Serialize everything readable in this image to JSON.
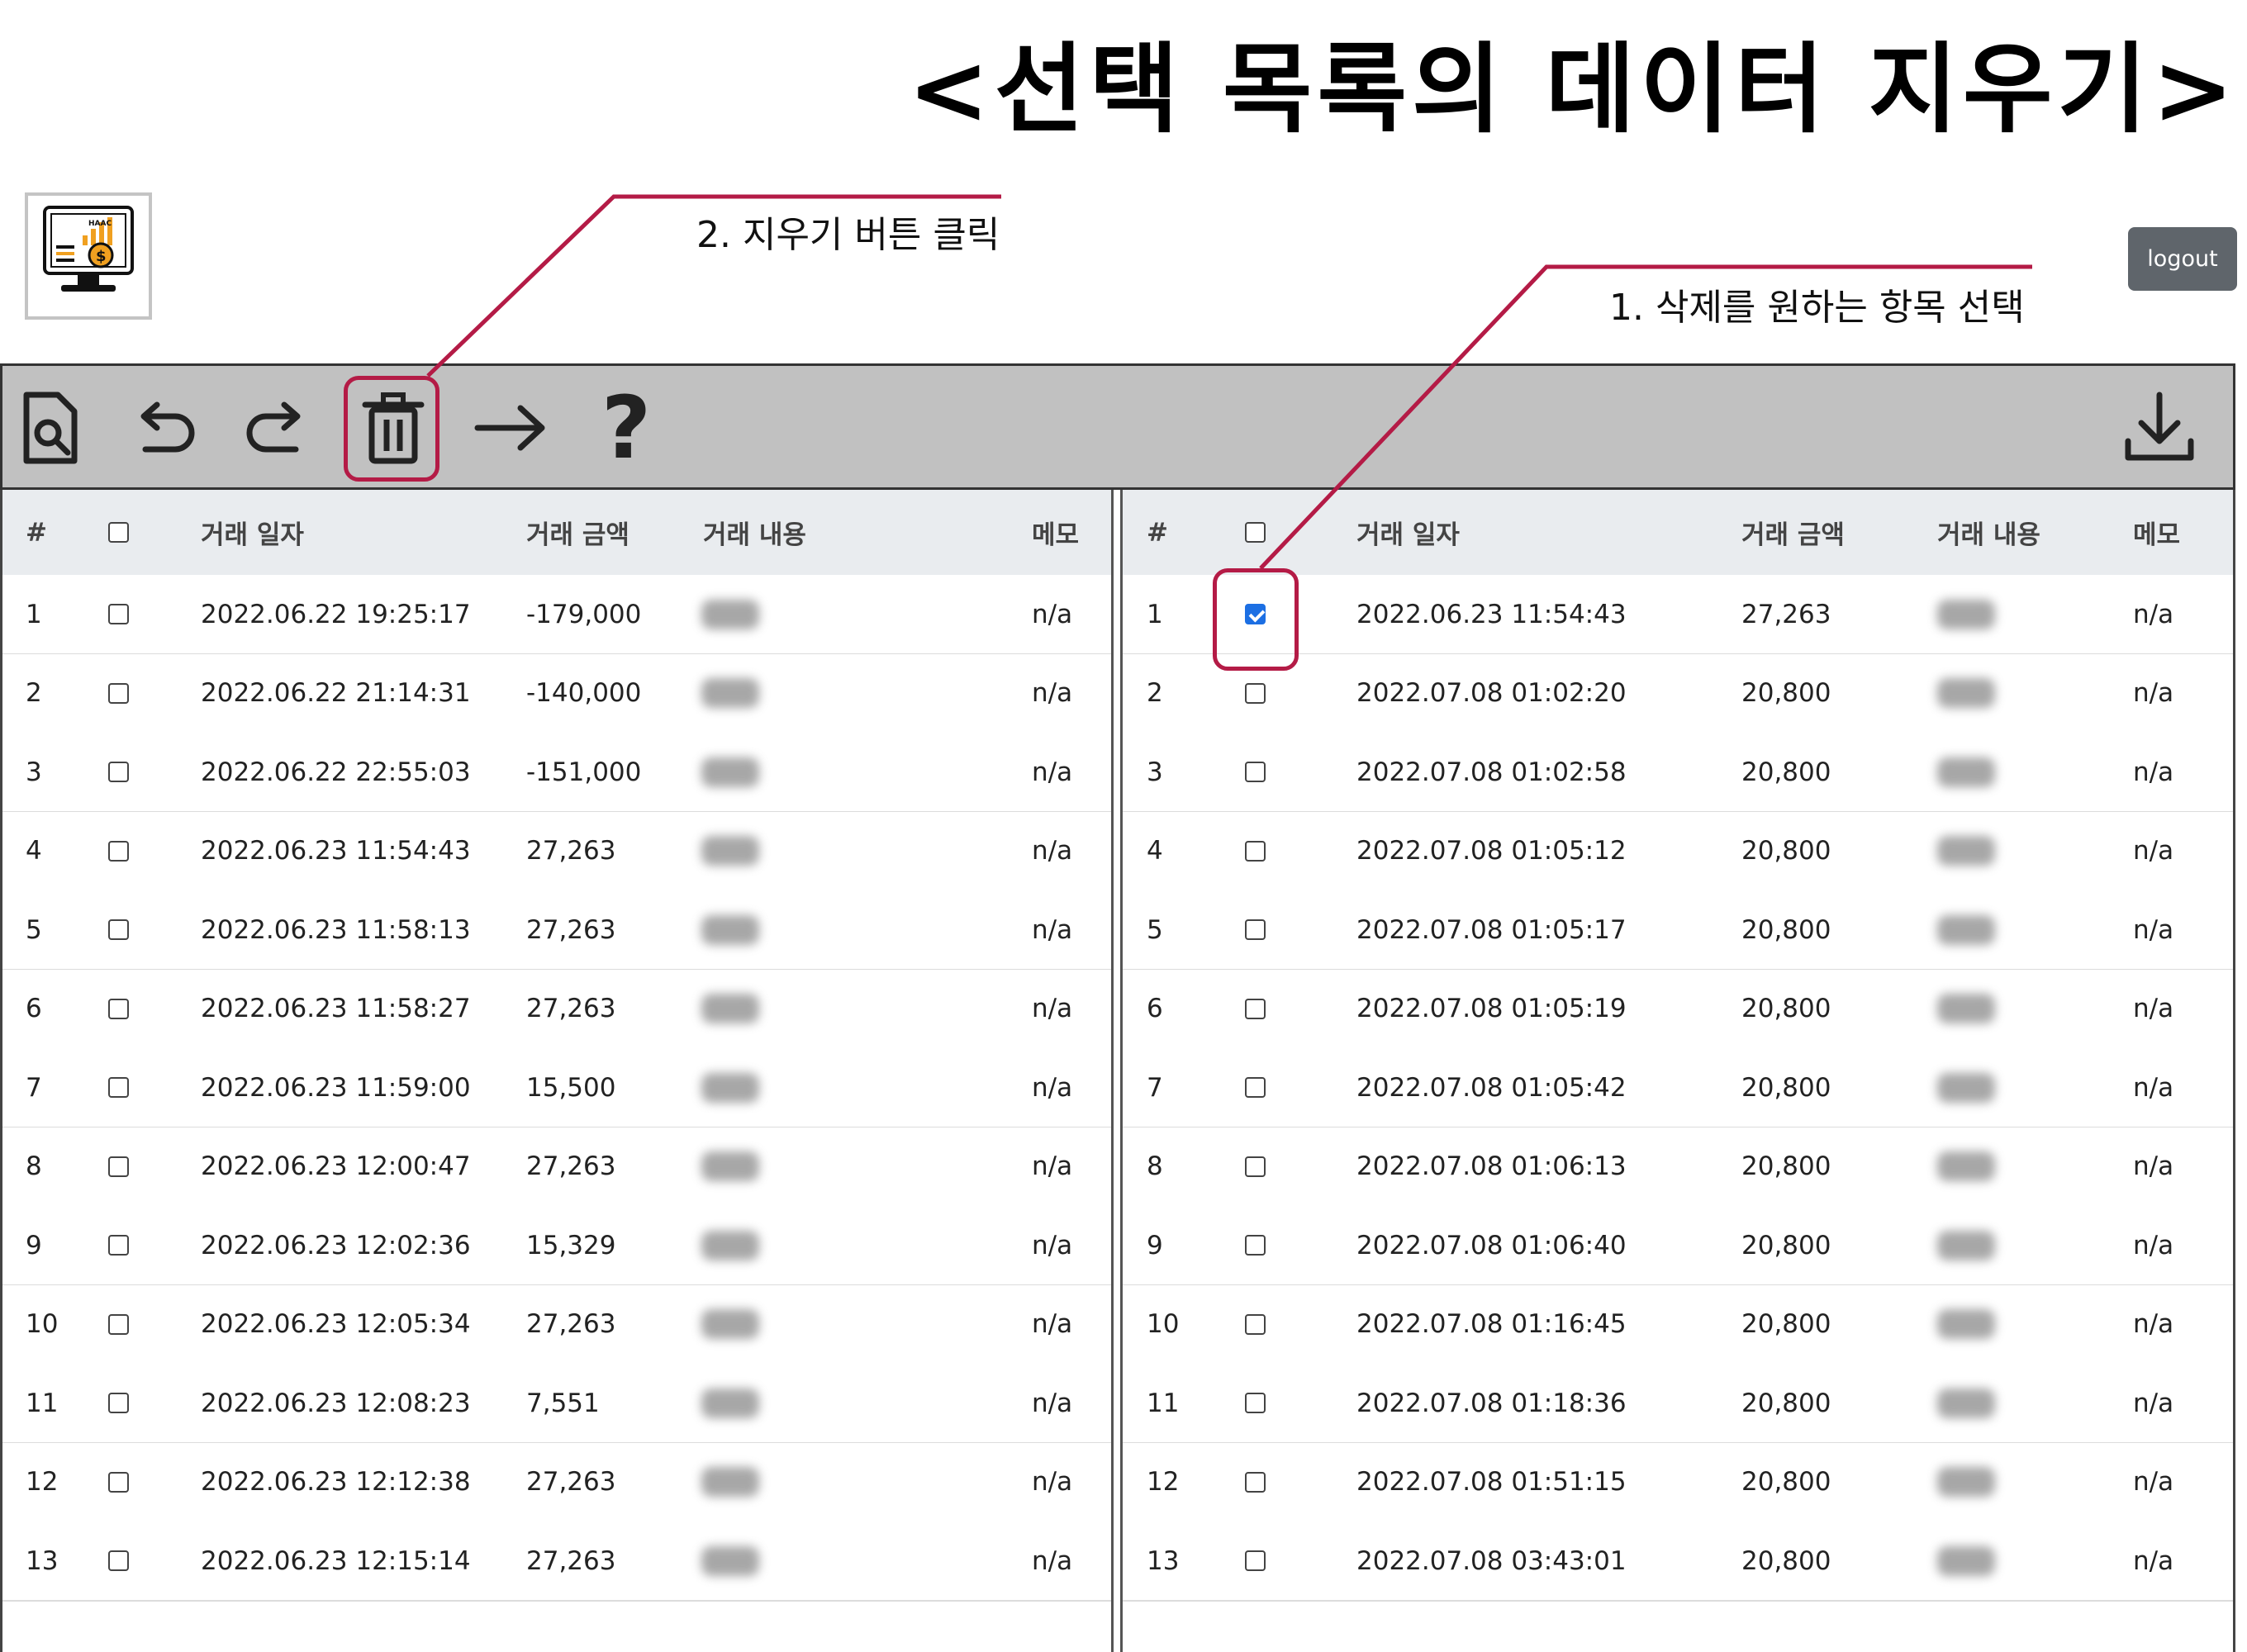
{
  "title": "<선택 목록의 데이터 지우기>",
  "logo": {
    "icon": "finance-monitor-logo-icon",
    "text": "HAAC"
  },
  "header": {
    "logout_label": "logout"
  },
  "toolbar": {
    "buttons": [
      {
        "icon": "file-search-icon"
      },
      {
        "icon": "undo-icon"
      },
      {
        "icon": "redo-icon"
      },
      {
        "icon": "trash-icon"
      },
      {
        "icon": "arrow-right-icon"
      },
      {
        "icon": "help-icon",
        "glyph": "?"
      },
      {
        "icon": "download-icon"
      }
    ]
  },
  "annotations": {
    "step1": "1. 삭제를 원하는 항목 선택",
    "step2": "2. 지우기 버튼 클릭",
    "color": "#b41b46"
  },
  "columns": {
    "num": "#",
    "date": "거래 일자",
    "amount": "거래 금액",
    "content": "거래 내용",
    "memo": "메모"
  },
  "left_table": {
    "rows": [
      {
        "num": "1",
        "date": "2022.06.22 19:25:17",
        "amount": "-179,000",
        "memo": "n/a",
        "checked": false
      },
      {
        "num": "2",
        "date": "2022.06.22 21:14:31",
        "amount": "-140,000",
        "memo": "n/a",
        "checked": false
      },
      {
        "num": "3",
        "date": "2022.06.22 22:55:03",
        "amount": "-151,000",
        "memo": "n/a",
        "checked": false
      },
      {
        "num": "4",
        "date": "2022.06.23 11:54:43",
        "amount": "27,263",
        "memo": "n/a",
        "checked": false
      },
      {
        "num": "5",
        "date": "2022.06.23 11:58:13",
        "amount": "27,263",
        "memo": "n/a",
        "checked": false
      },
      {
        "num": "6",
        "date": "2022.06.23 11:58:27",
        "amount": "27,263",
        "memo": "n/a",
        "checked": false
      },
      {
        "num": "7",
        "date": "2022.06.23 11:59:00",
        "amount": "15,500",
        "memo": "n/a",
        "checked": false
      },
      {
        "num": "8",
        "date": "2022.06.23 12:00:47",
        "amount": "27,263",
        "memo": "n/a",
        "checked": false
      },
      {
        "num": "9",
        "date": "2022.06.23 12:02:36",
        "amount": "15,329",
        "memo": "n/a",
        "checked": false
      },
      {
        "num": "10",
        "date": "2022.06.23 12:05:34",
        "amount": "27,263",
        "memo": "n/a",
        "checked": false
      },
      {
        "num": "11",
        "date": "2022.06.23 12:08:23",
        "amount": "7,551",
        "memo": "n/a",
        "checked": false
      },
      {
        "num": "12",
        "date": "2022.06.23 12:12:38",
        "amount": "27,263",
        "memo": "n/a",
        "checked": false
      },
      {
        "num": "13",
        "date": "2022.06.23 12:15:14",
        "amount": "27,263",
        "memo": "n/a",
        "checked": false
      }
    ]
  },
  "right_table": {
    "rows": [
      {
        "num": "1",
        "date": "2022.06.23 11:54:43",
        "amount": "27,263",
        "memo": "n/a",
        "checked": true
      },
      {
        "num": "2",
        "date": "2022.07.08 01:02:20",
        "amount": "20,800",
        "memo": "n/a",
        "checked": false
      },
      {
        "num": "3",
        "date": "2022.07.08 01:02:58",
        "amount": "20,800",
        "memo": "n/a",
        "checked": false
      },
      {
        "num": "4",
        "date": "2022.07.08 01:05:12",
        "amount": "20,800",
        "memo": "n/a",
        "checked": false
      },
      {
        "num": "5",
        "date": "2022.07.08 01:05:17",
        "amount": "20,800",
        "memo": "n/a",
        "checked": false
      },
      {
        "num": "6",
        "date": "2022.07.08 01:05:19",
        "amount": "20,800",
        "memo": "n/a",
        "checked": false
      },
      {
        "num": "7",
        "date": "2022.07.08 01:05:42",
        "amount": "20,800",
        "memo": "n/a",
        "checked": false
      },
      {
        "num": "8",
        "date": "2022.07.08 01:06:13",
        "amount": "20,800",
        "memo": "n/a",
        "checked": false
      },
      {
        "num": "9",
        "date": "2022.07.08 01:06:40",
        "amount": "20,800",
        "memo": "n/a",
        "checked": false
      },
      {
        "num": "10",
        "date": "2022.07.08 01:16:45",
        "amount": "20,800",
        "memo": "n/a",
        "checked": false
      },
      {
        "num": "11",
        "date": "2022.07.08 01:18:36",
        "amount": "20,800",
        "memo": "n/a",
        "checked": false
      },
      {
        "num": "12",
        "date": "2022.07.08 01:51:15",
        "amount": "20,800",
        "memo": "n/a",
        "checked": false
      },
      {
        "num": "13",
        "date": "2022.07.08 03:43:01",
        "amount": "20,800",
        "memo": "n/a",
        "checked": false
      }
    ]
  }
}
